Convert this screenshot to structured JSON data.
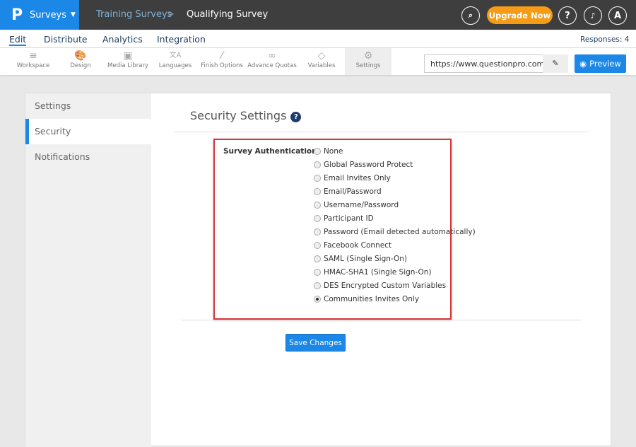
{
  "header": {
    "logo": "P",
    "app": "Surveys",
    "breadcrumb_parent": "Training Surveys",
    "breadcrumb_sep": ">",
    "breadcrumb_current": "Qualifying Survey",
    "upgrade": "Upgrade Now",
    "help": "?",
    "bell": "🔔",
    "avatar": "A",
    "search": "🔍"
  },
  "nav": {
    "tabs": [
      "Edit",
      "Distribute",
      "Analytics",
      "Integration"
    ],
    "active": "Edit",
    "responses": "Responses: 4"
  },
  "toolbar": {
    "items": [
      {
        "label": "Workspace",
        "icon": "≡"
      },
      {
        "label": "Design",
        "icon": "🎨"
      },
      {
        "label": "Media Library",
        "icon": "▣"
      },
      {
        "label": "Languages",
        "icon": "文A"
      },
      {
        "label": "Finish Options",
        "icon": "⁄"
      },
      {
        "label": "Advance Quotas",
        "icon": "∞"
      },
      {
        "label": "Variables",
        "icon": "◇"
      },
      {
        "label": "Settings",
        "icon": "⚙"
      }
    ],
    "active": "Settings",
    "url": "https://www.questionpro.com/t/A",
    "preview": "Preview"
  },
  "sidebar": {
    "items": [
      "Settings",
      "Security",
      "Notifications"
    ],
    "active": "Security"
  },
  "main": {
    "title": "Security Settings",
    "auth_label": "Survey Authentication:",
    "options": [
      "None",
      "Global Password Protect",
      "Email Invites Only",
      "Email/Password",
      "Username/Password",
      "Participant ID",
      "Password (Email detected automatically)",
      "Facebook Connect",
      "SAML (Single Sign-On)",
      "HMAC-SHA1 (Single Sign-On)",
      "DES Encrypted Custom Variables",
      "Communities Invites Only"
    ],
    "selected": "Communities Invites Only",
    "save": "Save Changes"
  },
  "colors": {
    "accent": "#1b87e6",
    "upgrade": "#f59b14",
    "highlight": "#d9343a",
    "topbar": "#3e3e3e"
  }
}
